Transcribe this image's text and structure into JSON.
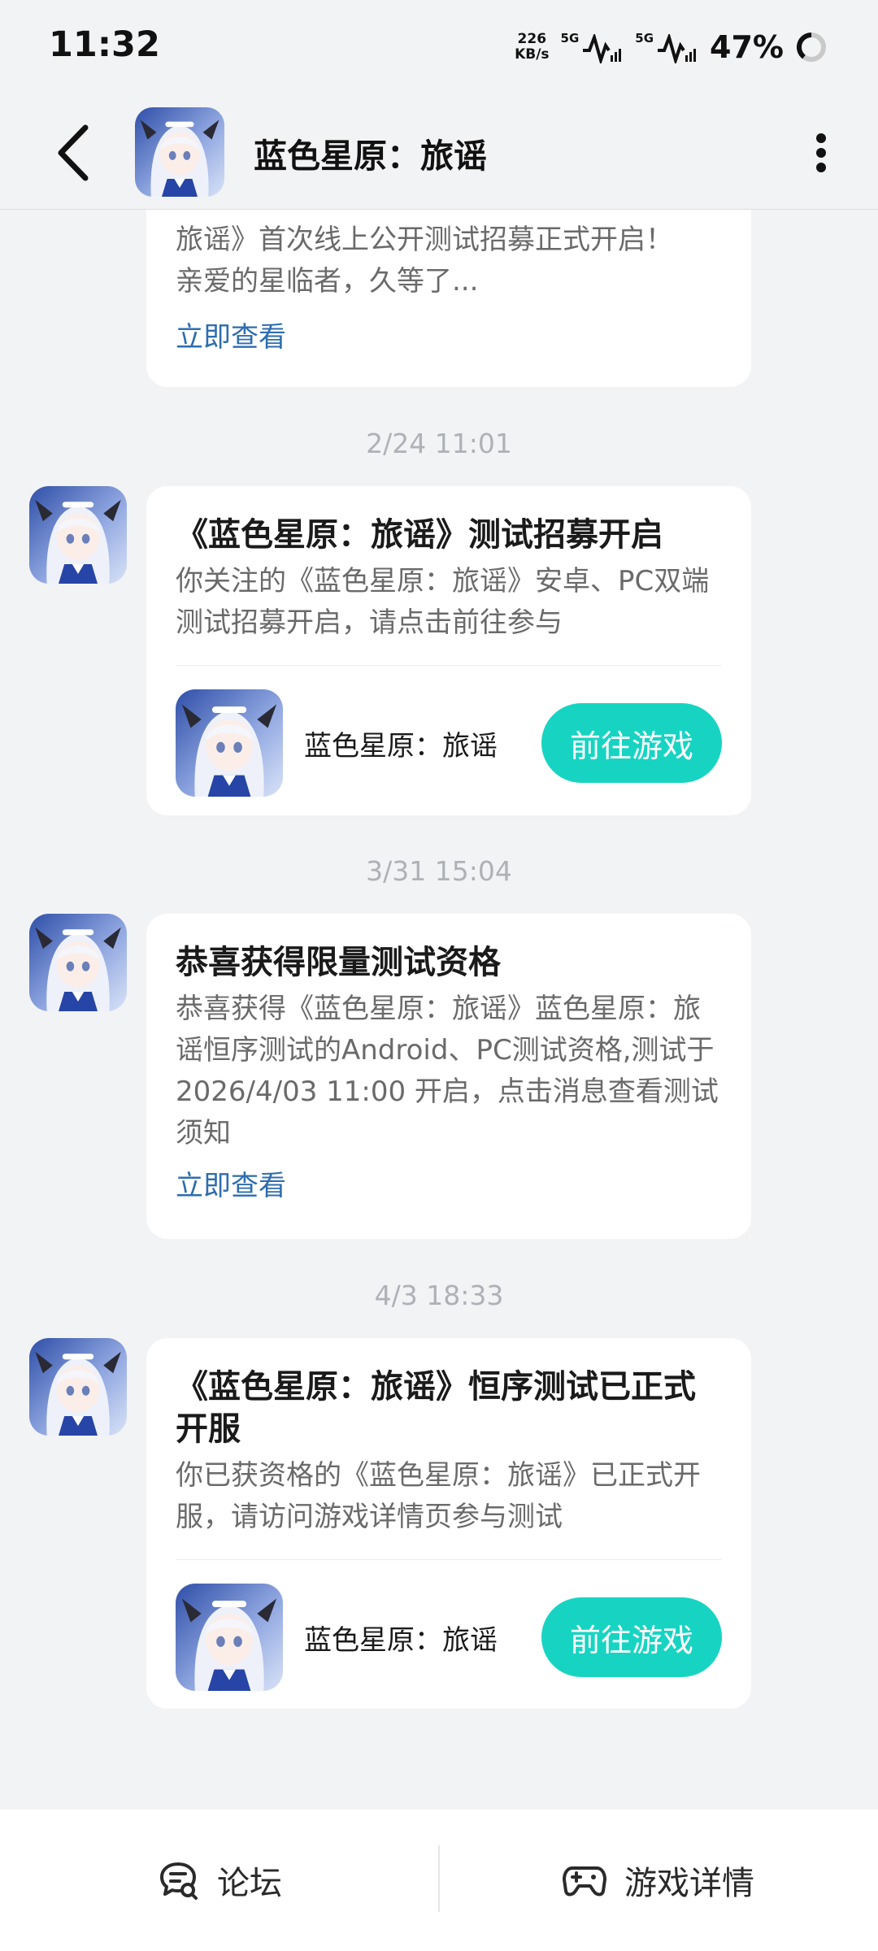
{
  "status_bar": {
    "time": "11:32",
    "net_speed_value": "226",
    "net_speed_unit": "KB/s",
    "signal1_tag": "5G",
    "signal2_tag": "5G",
    "battery": "47%"
  },
  "header": {
    "title": "蓝色星原：旅谣",
    "back_icon": "chevron-left-icon",
    "more_icon": "more-vertical-icon"
  },
  "messages": {
    "partial": {
      "desc_line1": "旅谣》首次线上公开测试招募正式开启！",
      "desc_line2": "亲爱的星临者，久等了...",
      "link": "立即查看"
    },
    "m1": {
      "time": "2/24  11:01",
      "title": "《蓝色星原：旅谣》测试招募开启",
      "desc": "你关注的《蓝色星原：旅谣》安卓、PC双端测试招募开启，请点击前往参与",
      "game_name": "蓝色星原：旅谣",
      "button": "前往游戏"
    },
    "m2": {
      "time": "3/31  15:04",
      "title": "恭喜获得限量测试资格",
      "desc": "恭喜获得《蓝色星原：旅谣》蓝色星原：旅谣恒序测试的Android、PC测试资格,测试于2026/4/03 11:00 开启，点击消息查看测试须知",
      "link": "立即查看"
    },
    "m3": {
      "time": "4/3  18:33",
      "title": "《蓝色星原：旅谣》恒序测试已正式开服",
      "desc": "你已获资格的《蓝色星原：旅谣》已正式开服，请访问游戏详情页参与测试",
      "game_name": "蓝色星原：旅谣",
      "button": "前往游戏"
    }
  },
  "bottom_bar": {
    "forum_label": "论坛",
    "details_label": "游戏详情"
  },
  "colors": {
    "accent": "#17d4c2",
    "link": "#2d6db0"
  }
}
